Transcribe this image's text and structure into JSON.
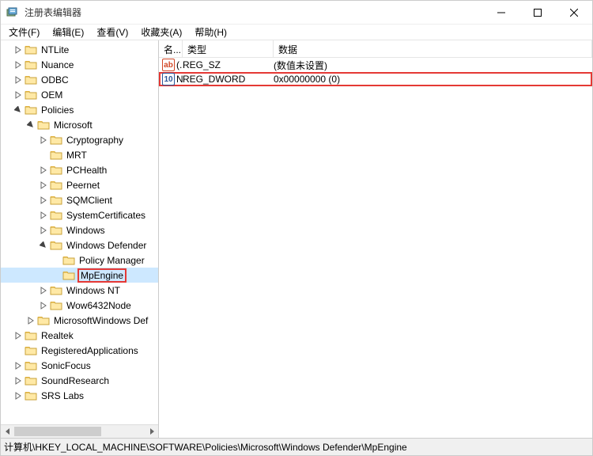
{
  "window": {
    "title": "注册表编辑器"
  },
  "menu": {
    "file": "文件(F)",
    "edit": "编辑(E)",
    "view": "查看(V)",
    "favorites": "收藏夹(A)",
    "help": "帮助(H)"
  },
  "columns": {
    "name": "名...",
    "type": "类型",
    "data": "数据"
  },
  "rows": [
    {
      "icon": "ab",
      "icon_color": "#d24726",
      "name": "(.",
      "type": "REG_SZ",
      "data": "(数值未设置)"
    },
    {
      "icon": "10",
      "icon_color": "#2b579a",
      "name": "N",
      "type": "REG_DWORD",
      "data": "0x00000000 (0)",
      "highlighted": true
    }
  ],
  "tree": [
    {
      "label": "NTLite",
      "depth": 1,
      "exp": "closed"
    },
    {
      "label": "Nuance",
      "depth": 1,
      "exp": "closed"
    },
    {
      "label": "ODBC",
      "depth": 1,
      "exp": "closed"
    },
    {
      "label": "OEM",
      "depth": 1,
      "exp": "closed"
    },
    {
      "label": "Policies",
      "depth": 1,
      "exp": "open"
    },
    {
      "label": "Microsoft",
      "depth": 2,
      "exp": "open"
    },
    {
      "label": "Cryptography",
      "depth": 3,
      "exp": "closed"
    },
    {
      "label": "MRT",
      "depth": 3,
      "exp": "none"
    },
    {
      "label": "PCHealth",
      "depth": 3,
      "exp": "closed"
    },
    {
      "label": "Peernet",
      "depth": 3,
      "exp": "closed"
    },
    {
      "label": "SQMClient",
      "depth": 3,
      "exp": "closed"
    },
    {
      "label": "SystemCertificates",
      "depth": 3,
      "exp": "closed"
    },
    {
      "label": "Windows",
      "depth": 3,
      "exp": "closed"
    },
    {
      "label": "Windows Defender",
      "depth": 3,
      "exp": "open"
    },
    {
      "label": "Policy Manager",
      "depth": 4,
      "exp": "none"
    },
    {
      "label": "MpEngine",
      "depth": 4,
      "exp": "none",
      "highlighted": true,
      "selected": true
    },
    {
      "label": "Windows NT",
      "depth": 3,
      "exp": "closed"
    },
    {
      "label": "Wow6432Node",
      "depth": 3,
      "exp": "closed"
    },
    {
      "label": "MicrosoftWindows Def",
      "depth": 2,
      "exp": "closed"
    },
    {
      "label": "Realtek",
      "depth": 1,
      "exp": "closed"
    },
    {
      "label": "RegisteredApplications",
      "depth": 1,
      "exp": "none"
    },
    {
      "label": "SonicFocus",
      "depth": 1,
      "exp": "closed"
    },
    {
      "label": "SoundResearch",
      "depth": 1,
      "exp": "closed"
    },
    {
      "label": "SRS Labs",
      "depth": 1,
      "exp": "closed"
    }
  ],
  "status": {
    "path": "计算机\\HKEY_LOCAL_MACHINE\\SOFTWARE\\Policies\\Microsoft\\Windows Defender\\MpEngine"
  },
  "colors": {
    "highlight": "#e53935",
    "folder_light": "#ffe9a6",
    "folder_dark": "#e3b23c"
  }
}
